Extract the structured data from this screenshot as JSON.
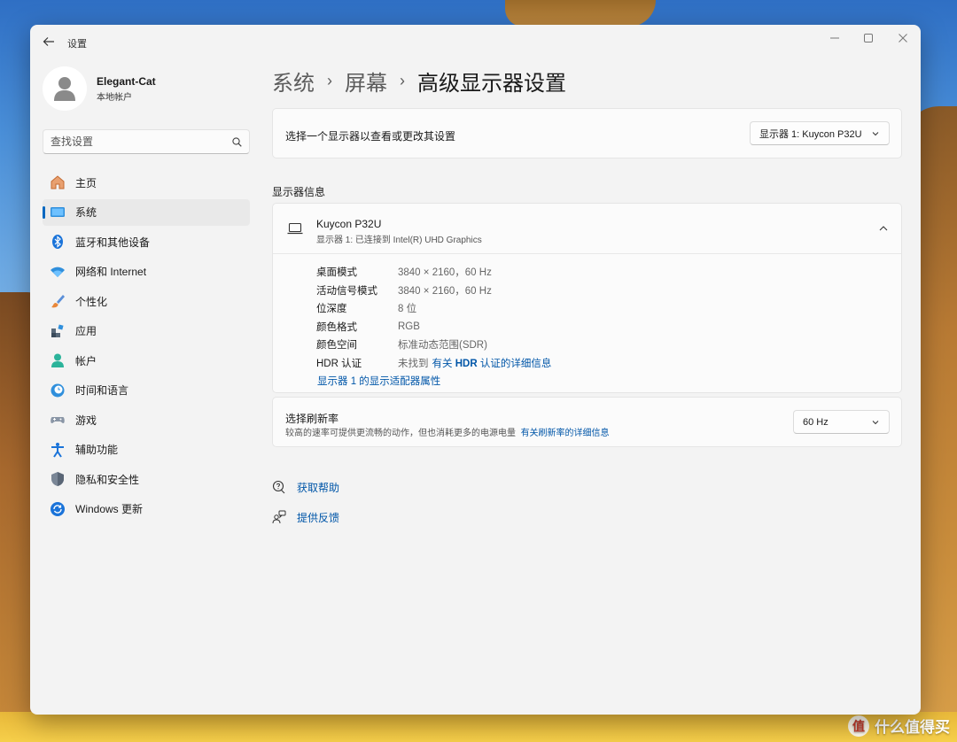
{
  "window": {
    "title": "设置",
    "back_icon": "arrow-left-icon",
    "controls": [
      "minimize-icon",
      "maximize-icon",
      "close-icon"
    ]
  },
  "profile": {
    "name": "Elegant-Cat",
    "account_type": "本地帐户"
  },
  "search": {
    "placeholder": "查找设置"
  },
  "sidebar": {
    "items": [
      {
        "label": "主页",
        "icon": "home-icon"
      },
      {
        "label": "系统",
        "icon": "system-icon",
        "active": true
      },
      {
        "label": "蓝牙和其他设备",
        "icon": "bluetooth-icon"
      },
      {
        "label": "网络和 Internet",
        "icon": "wifi-icon"
      },
      {
        "label": "个性化",
        "icon": "brush-icon"
      },
      {
        "label": "应用",
        "icon": "apps-icon"
      },
      {
        "label": "帐户",
        "icon": "account-icon"
      },
      {
        "label": "时间和语言",
        "icon": "clock-globe-icon"
      },
      {
        "label": "游戏",
        "icon": "gamepad-icon"
      },
      {
        "label": "辅助功能",
        "icon": "accessibility-icon"
      },
      {
        "label": "隐私和安全性",
        "icon": "shield-icon"
      },
      {
        "label": "Windows 更新",
        "icon": "update-icon"
      }
    ]
  },
  "breadcrumb": {
    "part1": "系统",
    "part2": "屏幕",
    "current": "高级显示器设置"
  },
  "select_display": {
    "label": "选择一个显示器以查看或更改其设置",
    "value": "显示器 1: Kuycon P32U"
  },
  "display_info": {
    "section_title": "显示器信息",
    "monitor_name": "Kuycon P32U",
    "monitor_sub": "显示器 1: 已连接到 Intel(R) UHD Graphics",
    "rows": [
      {
        "key": "桌面模式",
        "value": "3840 × 2160，60 Hz"
      },
      {
        "key": "活动信号模式",
        "value": "3840 × 2160，60 Hz"
      },
      {
        "key": "位深度",
        "value": "8 位"
      },
      {
        "key": "颜色格式",
        "value": "RGB"
      },
      {
        "key": "颜色空间",
        "value": "标准动态范围(SDR)"
      }
    ],
    "hdr_key": "HDR 认证",
    "hdr_value": "未找到",
    "hdr_link_prefix": "有关 ",
    "hdr_link_bold": "HDR",
    "hdr_link_suffix": " 认证的详细信息",
    "adapter_link": "显示器 1 的显示适配器属性"
  },
  "refresh": {
    "title": "选择刷新率",
    "desc": "较高的速率可提供更流畅的动作，但也消耗更多的电源电量",
    "link": "有关刷新率的详细信息",
    "value": "60 Hz"
  },
  "help": {
    "get_help": "获取帮助",
    "feedback": "提供反馈"
  },
  "watermark": {
    "badge": "值",
    "text": "什么值得买"
  },
  "colors": {
    "accent": "#0067c0",
    "link": "#0056a8"
  }
}
